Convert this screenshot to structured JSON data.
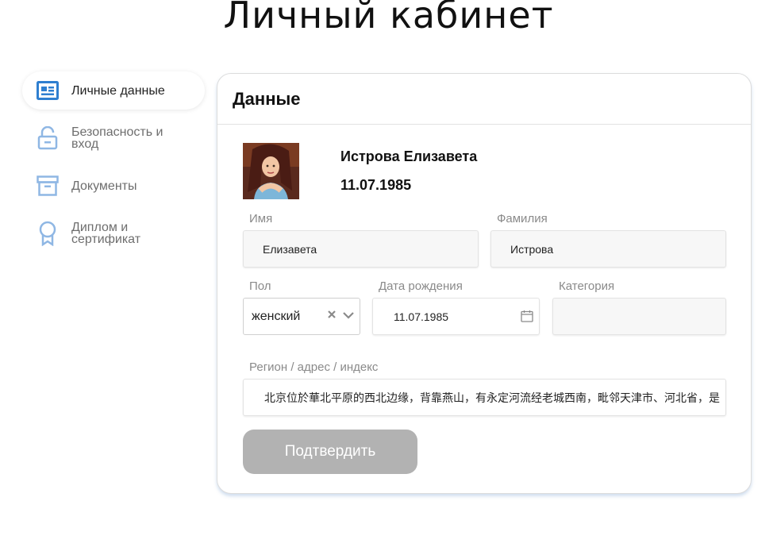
{
  "page": {
    "title": "Личный кабинет"
  },
  "sidebar": {
    "items": [
      {
        "label": "Личные данные",
        "icon": "id-card-icon",
        "active": true
      },
      {
        "label": "Безопасность и вход",
        "icon": "unlock-icon",
        "active": false
      },
      {
        "label": "Документы",
        "icon": "archive-box-icon",
        "active": false
      },
      {
        "label": "Диплом и сертификат",
        "icon": "award-icon",
        "active": false
      }
    ]
  },
  "card": {
    "title": "Данные",
    "profile": {
      "name": "Истрова Елизавета",
      "birth_date": "11.07.1985"
    },
    "form": {
      "first_name_label": "Имя",
      "first_name_value": "Елизавета",
      "last_name_label": "Фамилия",
      "last_name_value": "Истрова",
      "gender_label": "Пол",
      "gender_value": "женский",
      "birth_label": "Дата рождения",
      "birth_value": "11.07.1985",
      "category_label": "Категория",
      "category_value": "",
      "address_label": "Регион / адрес / индекс",
      "address_value": "北京位於華北平原的西北边缘，背靠燕山，有永定河流经老城西南，毗邻天津市、河北省，是"
    },
    "submit_label": "Подтвердить"
  },
  "colors": {
    "accent": "#2f7fd0",
    "icon_inactive": "#8fb7e4",
    "button_disabled": "#b2b2b2"
  }
}
